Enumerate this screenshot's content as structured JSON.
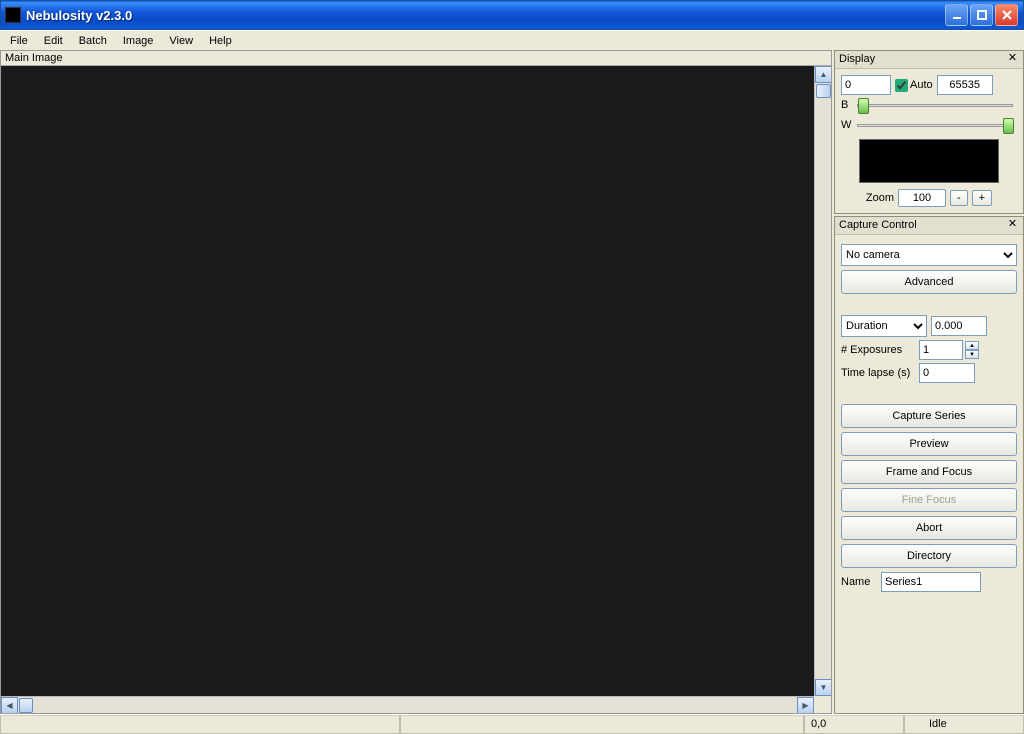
{
  "window": {
    "title": "Nebulosity v2.3.0"
  },
  "menu": {
    "items": [
      "File",
      "Edit",
      "Batch",
      "Image",
      "View",
      "Help"
    ]
  },
  "main": {
    "header": "Main Image"
  },
  "display": {
    "title": "Display",
    "black": "0",
    "white": "65535",
    "auto_label": "Auto",
    "b_label": "B",
    "w_label": "W",
    "zoom_label": "Zoom",
    "zoom_value": "100",
    "zoom_out": "-",
    "zoom_in": "+"
  },
  "capture": {
    "title": "Capture Control",
    "camera": "No camera",
    "advanced": "Advanced",
    "duration_label": "Duration",
    "duration_value": "0.000",
    "exposures_label": "# Exposures",
    "exposures_value": "1",
    "timelapse_label": "Time lapse (s)",
    "timelapse_value": "0",
    "capture_series": "Capture Series",
    "preview": "Preview",
    "frame_focus": "Frame and Focus",
    "fine_focus": "Fine Focus",
    "abort": "Abort",
    "directory": "Directory",
    "name_label": "Name",
    "name_value": "Series1"
  },
  "status": {
    "coords": "0,0",
    "state": "Idle"
  }
}
